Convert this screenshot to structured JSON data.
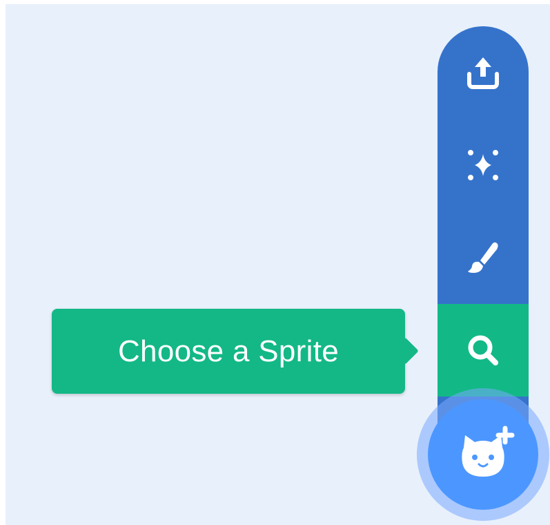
{
  "tooltip": {
    "text": "Choose a Sprite"
  },
  "menu": {
    "items": [
      {
        "icon": "upload-icon"
      },
      {
        "icon": "surprise-sparkle-icon"
      },
      {
        "icon": "paint-brush-icon"
      },
      {
        "icon": "search-icon",
        "active": true
      }
    ]
  },
  "main_button": {
    "icon": "add-sprite-cat-icon"
  },
  "colors": {
    "background": "#e8f0fb",
    "menu_blue": "#3573cb",
    "active_green": "#12b986",
    "main_button_blue": "#4c97ff"
  }
}
